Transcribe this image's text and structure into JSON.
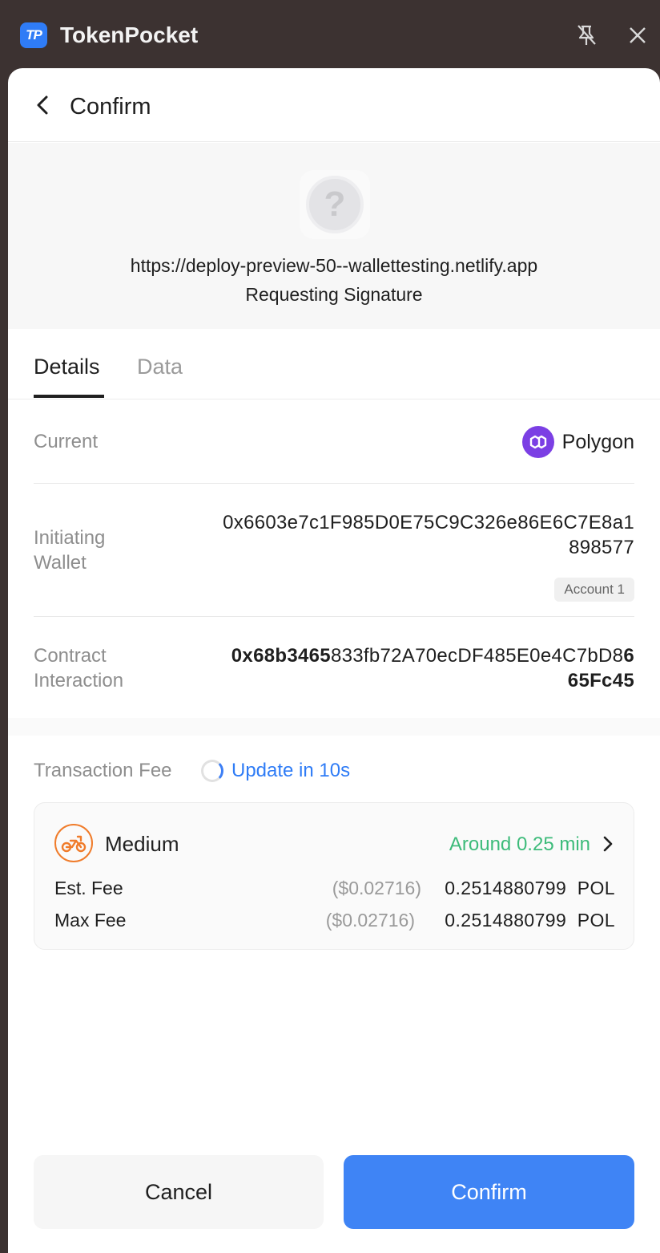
{
  "window": {
    "app_logo_text": "TP",
    "app_title": "TokenPocket"
  },
  "header": {
    "title": "Confirm"
  },
  "dapp": {
    "icon_glyph": "?",
    "url": "https://deploy-preview-50--wallettesting.netlify.app",
    "request": "Requesting Signature"
  },
  "tabs": [
    {
      "label": "Details",
      "active": true
    },
    {
      "label": "Data",
      "active": false
    }
  ],
  "details": {
    "current_label": "Current",
    "network": "Polygon",
    "initiating_label_1": "Initiating",
    "initiating_label_2": "Wallet",
    "wallet_address_line1": "0x6603e7c1F985D0E75C9C326e86E6C7E8a1",
    "wallet_address_line2": "898577",
    "account_badge": "Account 1",
    "contract_label_1": "Contract",
    "contract_label_2": "Interaction",
    "contract_address_bold_start": "0x68b3465",
    "contract_address_middle": "833fb72A70ecDF485E0e4C7bD8",
    "contract_address_bold_end_1": "6",
    "contract_address_bold_end_2": "65Fc45"
  },
  "fee": {
    "title": "Transaction Fee",
    "update_text": "Update in 10s",
    "speed": "Medium",
    "eta": "Around 0.25 min",
    "est_label": "Est. Fee",
    "est_usd": "($0.02716)",
    "est_amount": "0.2514880799  POL",
    "max_label": "Max Fee",
    "max_usd": "($0.02716)",
    "max_amount": "0.2514880799  POL"
  },
  "buttons": {
    "cancel": "Cancel",
    "confirm": "Confirm"
  },
  "colors": {
    "accent": "#3f84f5",
    "polygon": "#7b3fe4",
    "eta_green": "#3dbb7a",
    "bike_orange": "#f07c2b"
  },
  "icons": {
    "unpin": "unpin-icon",
    "close": "close-icon",
    "back": "back-icon",
    "polygon": "polygon-icon",
    "bike": "bike-icon",
    "chevron": "chevron-right-icon"
  }
}
